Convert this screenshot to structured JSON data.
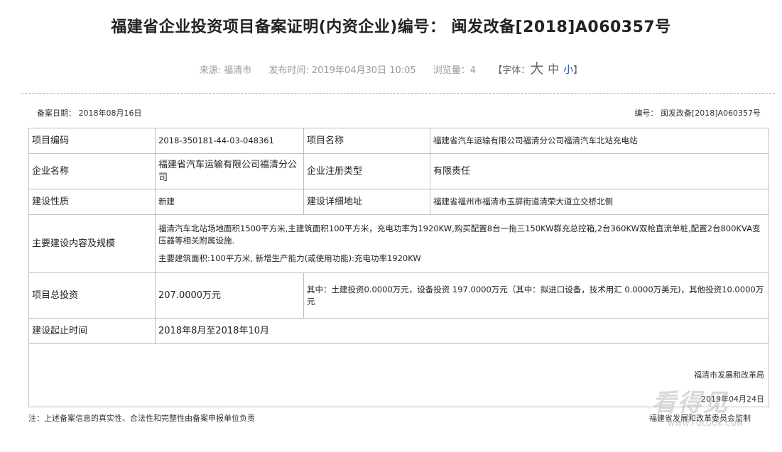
{
  "title": "福建省企业投资项目备案证明(内资企业)编号： 闽发改备[2018]A060357号",
  "meta": {
    "source": "来源: 福清市",
    "publish_time": "发布时间: 2019年04月30日 10:05",
    "views": "浏览量：4",
    "font_open": "【字体：",
    "font_big": "大",
    "font_mid": "中",
    "font_small": "小",
    "font_close": "】"
  },
  "record": {
    "date": "备案日期： 2018年08月16日",
    "number": "编号： 闽发改备[2018]A060357号"
  },
  "table": {
    "project_code_label": "项目编码",
    "project_code": "2018-350181-44-03-048361",
    "project_name_label": "项目名称",
    "project_name": "福建省汽车运输有限公司福清分公司福清汽车北站充电站",
    "company_label": "企业名称",
    "company": "福建省汽车运输有限公司福清分公司",
    "reg_type_label": "企业注册类型",
    "reg_type": "有限责任",
    "nature_label": "建设性质",
    "nature": "新建",
    "address_label": "建设详细地址",
    "address": "福建省福州市福清市玉屏街道清荣大道立交桥北侧",
    "scale_label": "主要建设内容及规模",
    "scale_line1": "福清汽车北站场地面积1500平方米,主建筑面积100平方米，充电功率为1920KW,购买配置8台一拖三150KW群充总控箱,2台360KW双枪直流单桩,配置2台800KVA变压器等相关附属设施.",
    "scale_line2": "主要建筑面积:100平方米, 新增生产能力(或使用功能):充电功率1920KW",
    "investment_label": "项目总投资",
    "investment": "207.0000万元",
    "investment_detail": "其中：土建投资0.0000万元，设备投资 197.0000万元（其中：拟进口设备，技术用汇 0.0000万美元)，其他投资10.0000万元",
    "period_label": "建设起止时间",
    "period": "2018年8月至2018年10月"
  },
  "signature": {
    "org": "福清市发展和改革局",
    "date": "2019年04月24日"
  },
  "footer": {
    "note": "注：上述备案信息的真实性、合法性和完整性由备案申报单位负责",
    "org": "福建省发展和改革委员会监制"
  },
  "watermark": {
    "text": "看得见",
    "url": "WWW.FQLOOK.COM"
  }
}
